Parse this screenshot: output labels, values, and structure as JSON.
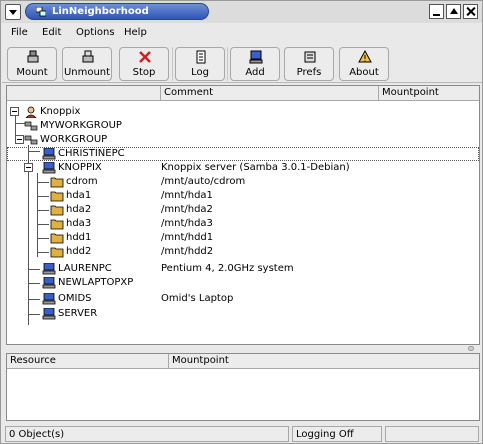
{
  "window": {
    "title": "LinNeighborhood"
  },
  "menu": [
    "File",
    "Edit",
    "Options",
    "Help"
  ],
  "toolbar": [
    {
      "label": "Mount",
      "icon": "mount-icon"
    },
    {
      "label": "Unmount",
      "icon": "unmount-icon"
    },
    {
      "label": "Stop",
      "icon": "stop-icon"
    },
    {
      "label": "Log",
      "icon": "log-icon"
    },
    {
      "label": "Add",
      "icon": "add-machine-icon"
    },
    {
      "label": "Prefs",
      "icon": "prefs-icon"
    },
    {
      "label": "About",
      "icon": "about-icon"
    }
  ],
  "main_list": {
    "columns": [
      "",
      "Comment",
      "Mountpoint"
    ],
    "rows": [
      {
        "name": "Knoppix",
        "comment": "",
        "icon": "user-icon"
      },
      {
        "name": "MYWORKGROUP",
        "comment": "",
        "icon": "workgroup-icon"
      },
      {
        "name": "WORKGROUP",
        "comment": "",
        "icon": "workgroup-icon"
      },
      {
        "name": "CHRISTINEPC",
        "comment": "",
        "icon": "computer-icon"
      },
      {
        "name": "KNOPPIX",
        "comment": "Knoppix server (Samba 3.0.1-Debian)",
        "icon": "computer-icon"
      },
      {
        "name": "cdrom",
        "comment": "/mnt/auto/cdrom",
        "icon": "folder-icon"
      },
      {
        "name": "hda1",
        "comment": "/mnt/hda1",
        "icon": "folder-icon"
      },
      {
        "name": "hda2",
        "comment": "/mnt/hda2",
        "icon": "folder-icon"
      },
      {
        "name": "hda3",
        "comment": "/mnt/hda3",
        "icon": "folder-icon"
      },
      {
        "name": "hdd1",
        "comment": "/mnt/hdd1",
        "icon": "folder-icon"
      },
      {
        "name": "hdd2",
        "comment": "/mnt/hdd2",
        "icon": "folder-icon"
      },
      {
        "name": "LAURENPC",
        "comment": "Pentium 4, 2.0GHz system",
        "icon": "computer-icon"
      },
      {
        "name": "NEWLAPTOPXP",
        "comment": "",
        "icon": "computer-icon"
      },
      {
        "name": "OMIDS",
        "comment": "Omid's Laptop",
        "icon": "computer-icon"
      },
      {
        "name": "SERVER",
        "comment": "",
        "icon": "computer-icon"
      }
    ],
    "selected": "CHRISTINEPC"
  },
  "lower_list": {
    "columns": [
      "Resource",
      "Mountpoint"
    ]
  },
  "status": {
    "objects": "0 Object(s)",
    "logging": "Logging Off"
  },
  "colors": {
    "title_active": "#2f56b5",
    "folder": "#e0b040",
    "computer": "#3a5fc8"
  }
}
